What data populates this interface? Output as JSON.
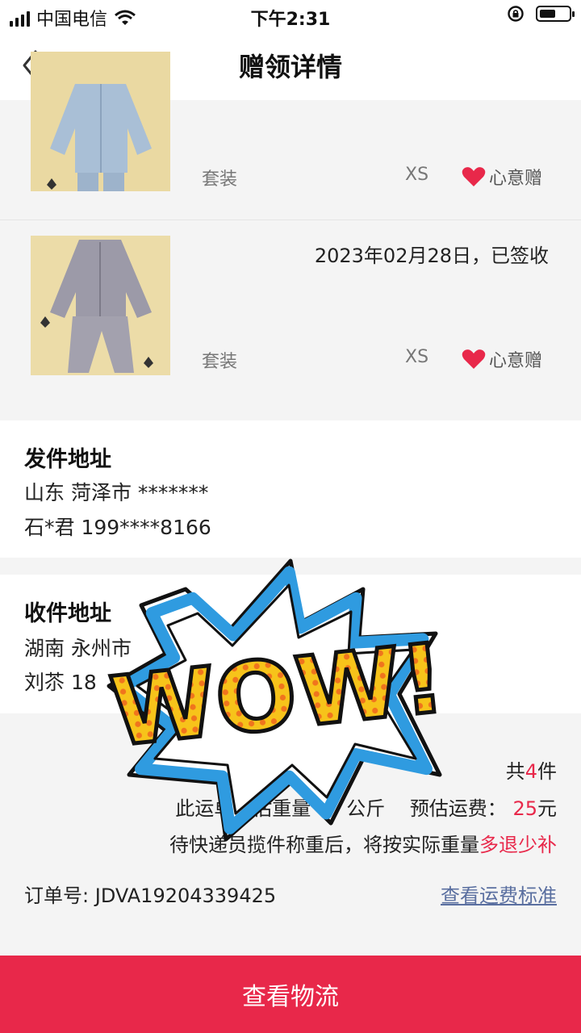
{
  "status_bar": {
    "carrier": "中国电信",
    "time": "下午2:31",
    "icons": [
      "signal-icon",
      "wifi-icon",
      "rotation-lock-icon",
      "battery-icon"
    ],
    "battery_level": 0.55
  },
  "nav": {
    "title": "赠领详情",
    "back_icon": "chevron-left-icon"
  },
  "items": [
    {
      "category": "套装",
      "size": "XS",
      "tag": "心意赠",
      "tag_icon": "heart-icon"
    },
    {
      "status": "2023年02月28日，已签收",
      "category": "套装",
      "size": "XS",
      "tag": "心意赠",
      "tag_icon": "heart-icon"
    }
  ],
  "sender": {
    "title": "发件地址",
    "region": "山东 菏泽市 *******",
    "contact": "石*君 199****8166"
  },
  "receiver": {
    "title": "收件地址",
    "region": "湖南 永州市",
    "contact": "刘苶 18"
  },
  "summary": {
    "count_prefix": "共",
    "count": "4",
    "count_suffix": "件",
    "weight_prefix": "此运单预估重量",
    "weight_suffix": "公斤",
    "fee_label": "预估运费：",
    "fee_value": "25",
    "fee_unit": "元",
    "note_prefix": "待快递员揽件称重后，将按实际重量",
    "note_highlight": "多退少补",
    "order_label": "订单号:",
    "order_number": "JDVA19204339425",
    "rate_link": "查看运费标准"
  },
  "cta": {
    "label": "查看物流"
  },
  "sticker": {
    "text": "WOW!"
  },
  "colors": {
    "accent": "#e8284a",
    "link": "#5a6fa0",
    "sticker_blue": "#2f9be0",
    "sticker_yellow": "#f7c31a",
    "sticker_dots": "#f0741d"
  }
}
